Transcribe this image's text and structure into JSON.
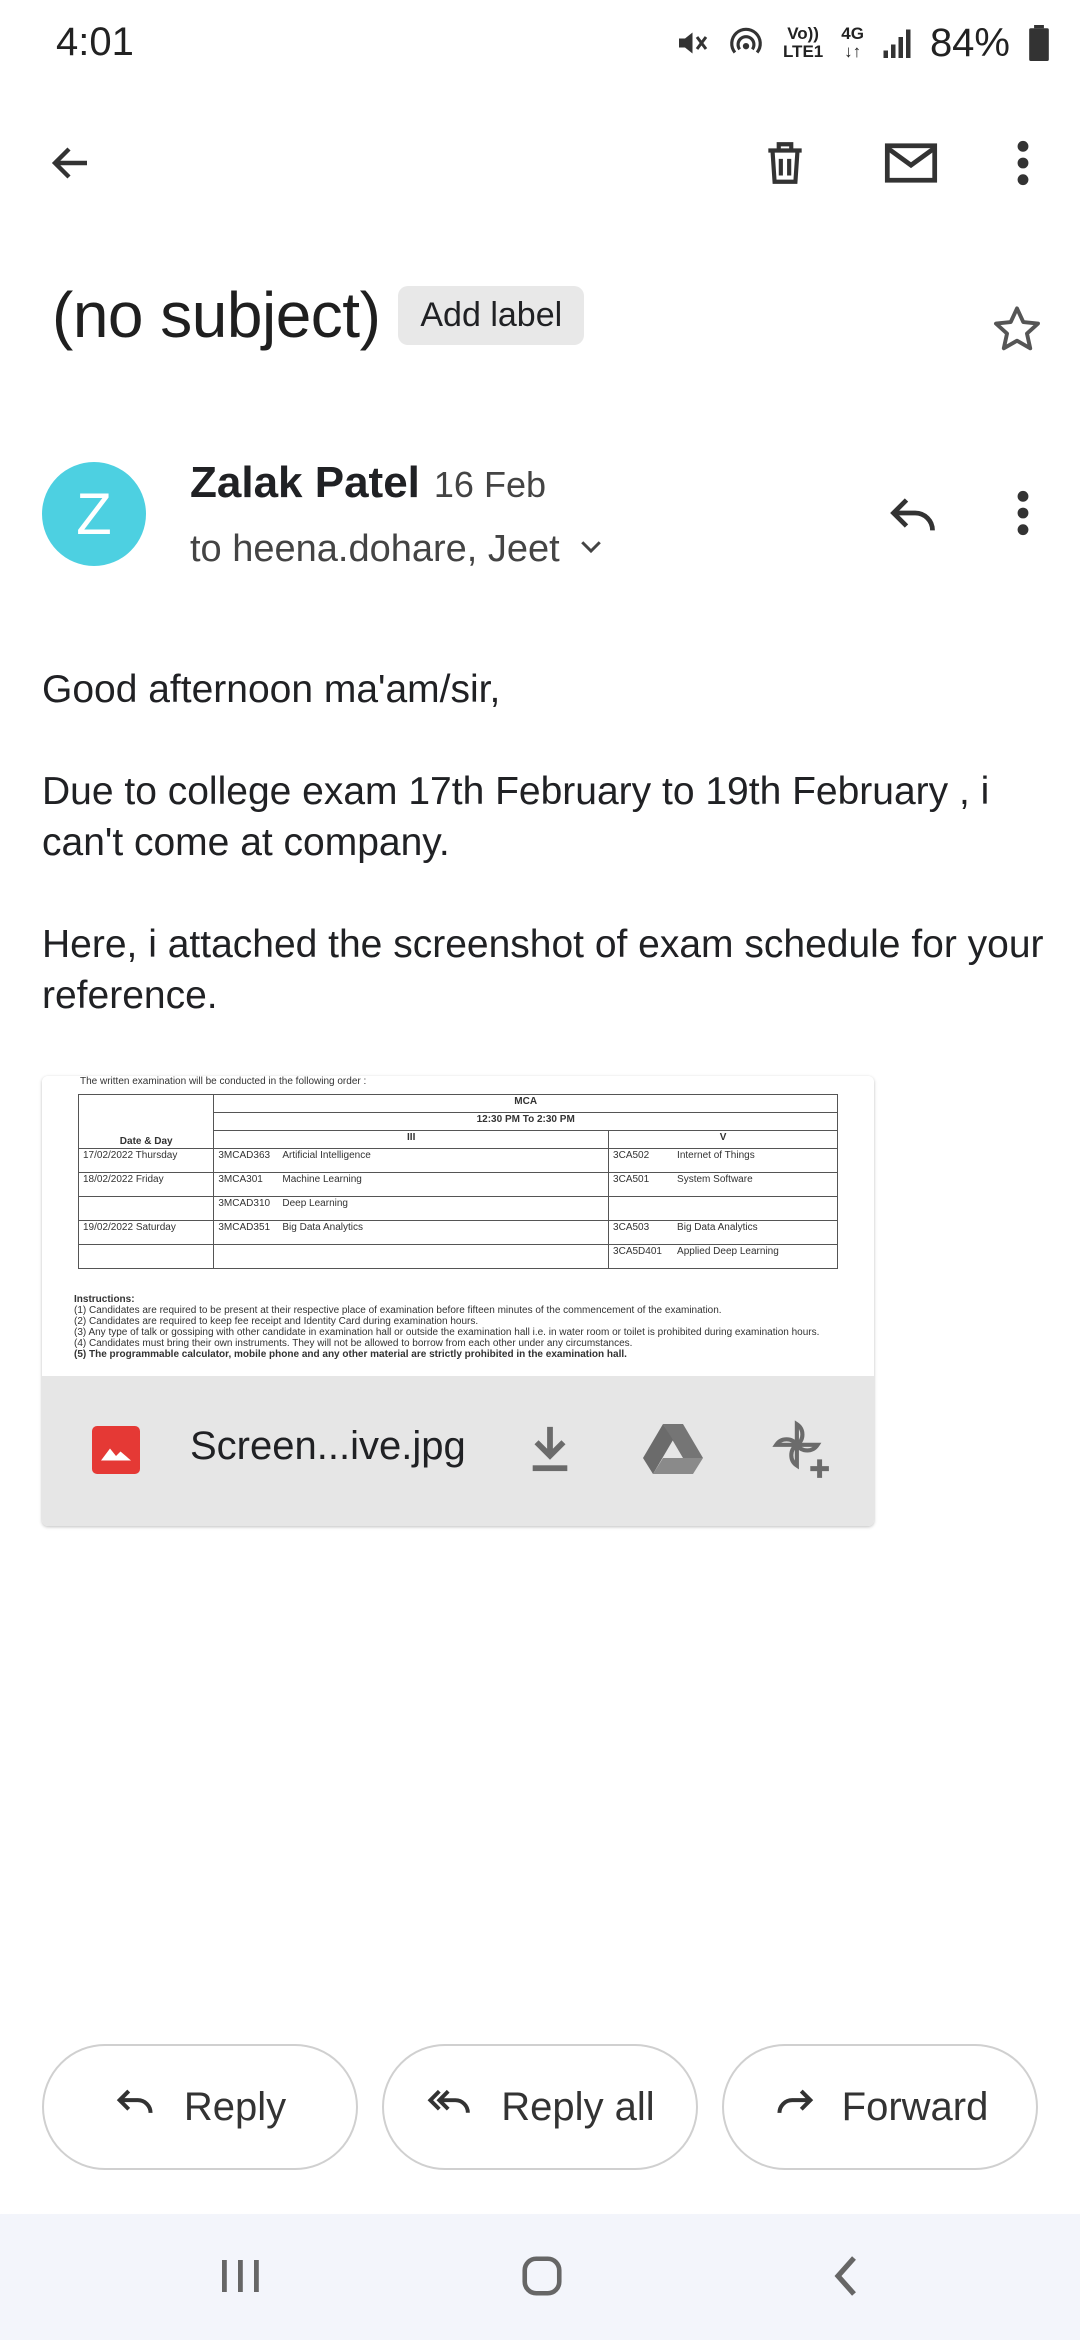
{
  "status_bar": {
    "time": "4:01",
    "lte_top": "Vo))",
    "lte_bottom": "LTE1",
    "network": "4G",
    "battery": "84%",
    "icons": [
      "mute-icon",
      "hotspot-icon",
      "volte-icon",
      "4g-icon",
      "signal-icon",
      "battery-icon"
    ]
  },
  "toolbar": {
    "icons": [
      "back-arrow-icon",
      "trash-icon",
      "mail-icon",
      "more-vert-icon"
    ]
  },
  "email": {
    "subject": "(no subject)",
    "add_label": "Add label",
    "sender_initial": "Z",
    "sender_name": "Zalak Patel",
    "date": "16 Feb",
    "recipients": "to heena.dohare, Jeet",
    "body": [
      "Good afternoon ma'am/sir,",
      "Due to college exam 17th February to 19th February , i can't come at company.",
      "Here, i attached the screenshot of exam schedule for your reference."
    ]
  },
  "attachment": {
    "filename": "Screen...ive.jpg",
    "preview": {
      "intro": "The written examination will be conducted in the following order :",
      "program": "MCA",
      "time": "12:30 PM To 2:30 PM",
      "col_date": "Date & Day",
      "sem_a": "III",
      "sem_b": "V",
      "rows": [
        {
          "date": "17/02/2022 Thursday",
          "a_code": "3MCAD363",
          "a_subject": "Artificial Intelligence",
          "b_code": "3CA502",
          "b_subject": "Internet of Things"
        },
        {
          "date": "18/02/2022 Friday",
          "a_code": "3MCA301",
          "a_subject": "Machine Learning",
          "b_code": "3CA501",
          "b_subject": "System Software"
        },
        {
          "date": "",
          "a_code": "3MCAD310",
          "a_subject": "Deep Learning",
          "b_code": "",
          "b_subject": ""
        },
        {
          "date": "19/02/2022 Saturday",
          "a_code": "3MCAD351",
          "a_subject": "Big Data Analytics",
          "b_code": "3CA503",
          "b_subject": "Big Data Analytics"
        },
        {
          "date": "",
          "a_code": "",
          "a_subject": "",
          "b_code": "3CA5D401",
          "b_subject": "Applied Deep Learning"
        }
      ],
      "instructions_title": "Instructions:",
      "instructions": [
        "(1) Candidates are required to be present at their respective place of examination before fifteen minutes of the commencement of the examination.",
        "(2) Candidates are required to keep fee receipt and Identity Card during examination hours.",
        "(3) Any type of talk or gossiping with other candidate in examination hall or outside the examination hall i.e. in water room or toilet is prohibited during examination hours.",
        "(4) Candidates must bring their own instruments. They will not be allowed to borrow from each other under any circumstances.",
        "(5) The programmable calculator, mobile phone and any other material are strictly prohibited in the examination hall."
      ]
    }
  },
  "actions": {
    "reply": "Reply",
    "reply_all": "Reply all",
    "forward": "Forward"
  },
  "colors": {
    "avatar": "#4dd0e1",
    "image_icon": "#e53935",
    "nav_bar": "#f3f5fb"
  }
}
